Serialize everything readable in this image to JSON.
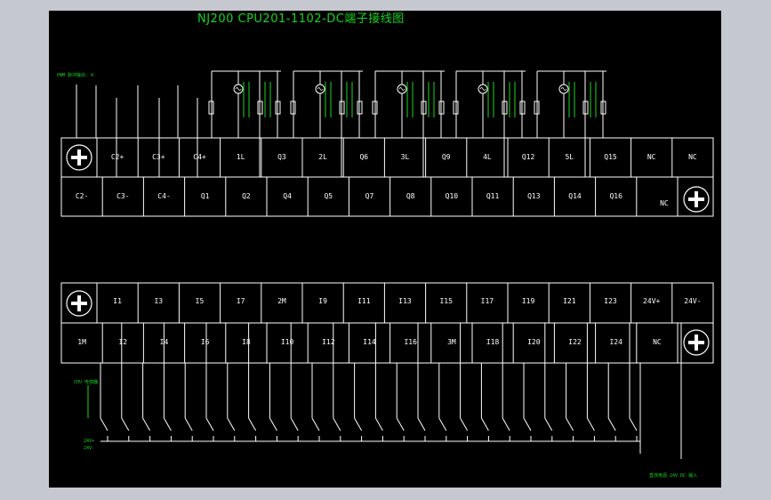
{
  "title": "NJ200 CPU201-1102-DC端子接线图",
  "colors": {
    "background": "#000000",
    "lines": "#ffffff",
    "annotation": "#19d61f",
    "frame": "#c6c8cf"
  },
  "icons": [
    "terminal-screw-icon",
    "lamp-load-icon",
    "resistor-icon"
  ],
  "output_block": {
    "top_row": [
      "C2+",
      "C3+",
      "C4+",
      "1L",
      "Q3",
      "2L",
      "Q6",
      "3L",
      "Q9",
      "4L",
      "Q12",
      "5L",
      "Q15",
      "NC",
      "NC"
    ],
    "bottom_row": [
      "C2-",
      "C3-",
      "C4-",
      "Q1",
      "Q2",
      "Q4",
      "Q5",
      "Q7",
      "Q8",
      "Q10",
      "Q11",
      "Q13",
      "Q14",
      "Q16",
      "NC"
    ]
  },
  "input_block": {
    "top_row": [
      "I1",
      "I3",
      "I5",
      "I7",
      "2M",
      "I9",
      "I11",
      "I13",
      "I15",
      "I17",
      "I19",
      "I21",
      "I23",
      "24V+",
      "24V-"
    ],
    "bottom_row": [
      "1M",
      "I2",
      "I4",
      "I6",
      "I8",
      "I10",
      "I12",
      "I14",
      "I16",
      "3M",
      "I18",
      "I20",
      "I22",
      "I24",
      "NC"
    ]
  },
  "annotations": {
    "analog_note": "PWM 脉冲输出: 4",
    "left_input_note": "CPU 传感器",
    "sink_note": "24V+",
    "source_note": "24V-",
    "power_note": "直流电源 24V DC 输入"
  }
}
